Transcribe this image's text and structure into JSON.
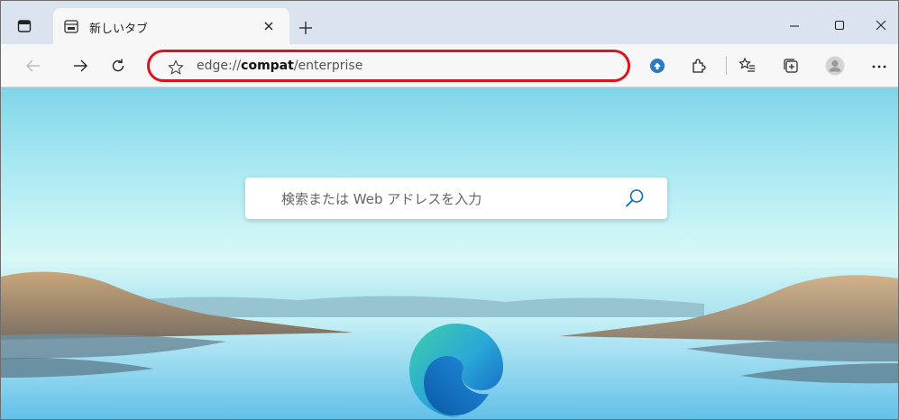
{
  "tabs": [
    {
      "title": "新しいタブ"
    }
  ],
  "toolbar": {
    "address": {
      "scheme": "edge://",
      "host": "compat",
      "path": "/enterprise"
    }
  },
  "newtab": {
    "search_placeholder": "検索または Web アドレスを入力"
  },
  "colors": {
    "tabstrip_bg": "#dbe3ef",
    "toolbar_bg": "#f7f7f7",
    "highlight_red": "#d9141e",
    "accent_blue": "#0f6cbd"
  },
  "icons": [
    "tab-actions-icon",
    "new-tab-page-icon",
    "close-tab-icon",
    "new-tab-icon",
    "minimize-icon",
    "maximize-icon",
    "window-close-icon",
    "back-icon",
    "forward-icon",
    "refresh-icon",
    "favorite-star-icon",
    "shield-extension-icon",
    "extensions-icon",
    "favorites-icon",
    "collections-icon",
    "profile-avatar-icon",
    "more-menu-icon",
    "search-icon",
    "edge-logo-icon"
  ]
}
